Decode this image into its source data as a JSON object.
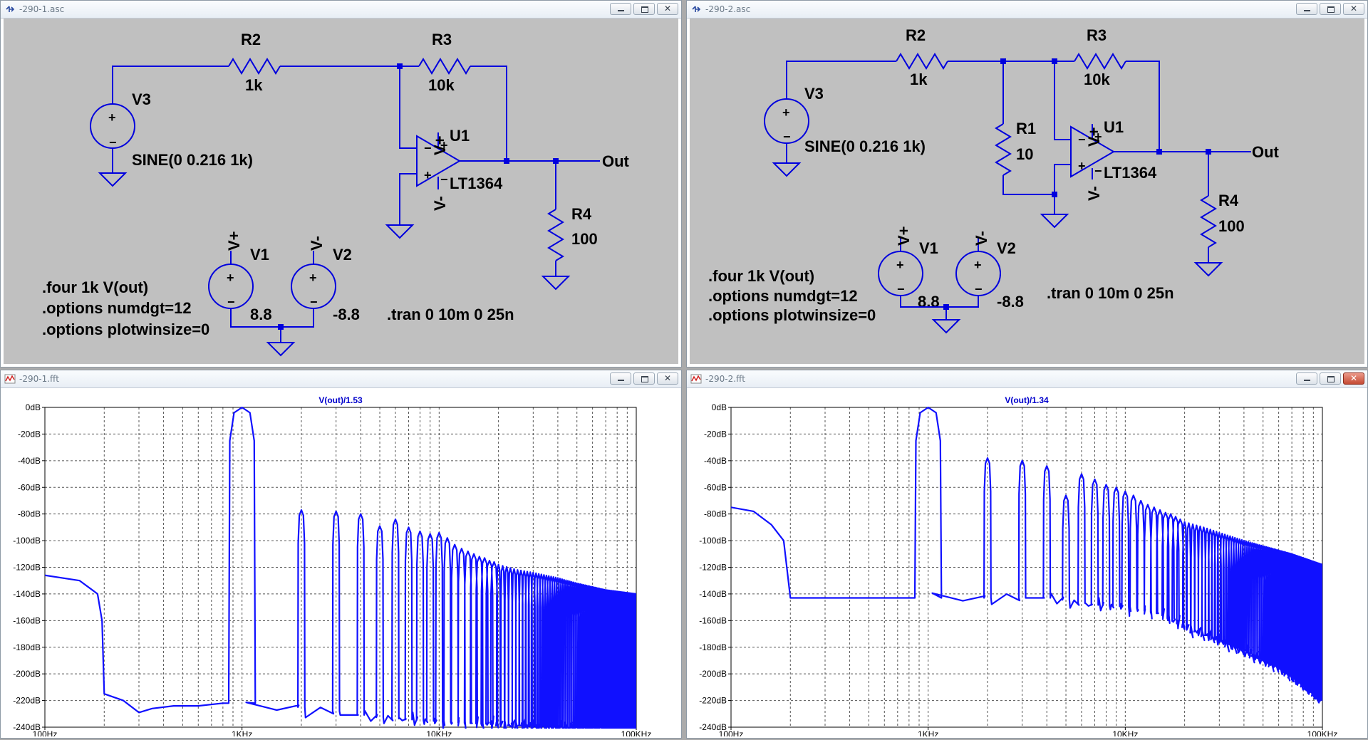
{
  "windows": {
    "sch1": {
      "title": "-290-1.asc"
    },
    "sch2": {
      "title": "-290-2.asc"
    },
    "fft1": {
      "title": "-290-1.fft"
    },
    "fft2": {
      "title": "-290-2.fft"
    }
  },
  "schematic1": {
    "r2": {
      "name": "R2",
      "value": "1k"
    },
    "r3": {
      "name": "R3",
      "value": "10k"
    },
    "r4": {
      "name": "R4",
      "value": "100"
    },
    "v3": {
      "name": "V3",
      "value": "SINE(0 0.216 1k)"
    },
    "u1": {
      "name": "U1",
      "model": "LT1364",
      "vplus": "V+",
      "vminus": "V-"
    },
    "v1": {
      "name": "V1",
      "value": "8.8",
      "net": "V+"
    },
    "v2": {
      "name": "V2",
      "value": "-8.8",
      "net": "V-"
    },
    "out": "Out",
    "directives": [
      ".four 1k V(out)",
      ".options numdgt=12",
      ".options plotwinsize=0"
    ],
    "tran": ".tran 0 10m 0 25n"
  },
  "schematic2": {
    "r1": {
      "name": "R1",
      "value": "10"
    },
    "r2": {
      "name": "R2",
      "value": "1k"
    },
    "r3": {
      "name": "R3",
      "value": "10k"
    },
    "r4": {
      "name": "R4",
      "value": "100"
    },
    "v3": {
      "name": "V3",
      "value": "SINE(0 0.216 1k)"
    },
    "u1": {
      "name": "U1",
      "model": "LT1364",
      "vplus": "V+",
      "vminus": "V-"
    },
    "v1": {
      "name": "V1",
      "value": "8.8",
      "net": "V+"
    },
    "v2": {
      "name": "V2",
      "value": "-8.8",
      "net": "V-"
    },
    "out": "Out",
    "directives": [
      ".four 1k V(out)",
      ".options numdgt=12",
      ".options plotwinsize=0"
    ],
    "tran": ".tran 0 10m 0 25n"
  },
  "chart_data": [
    {
      "type": "line",
      "title": "V(out)/1.53",
      "x_scale": "log",
      "xlim": [
        100,
        100000
      ],
      "ylim": [
        -240,
        0
      ],
      "y_ticks": [
        "0dB",
        "-20dB",
        "-40dB",
        "-60dB",
        "-80dB",
        "-100dB",
        "-120dB",
        "-140dB",
        "-160dB",
        "-180dB",
        "-200dB",
        "-220dB",
        "-240dB"
      ],
      "x_ticks": [
        "100Hz",
        "1KHz",
        "10KHz",
        "100KHz"
      ],
      "grid": true,
      "series": [
        {
          "color": "#1010ff",
          "baseline": [
            [
              100,
              -126
            ],
            [
              150,
              -130
            ],
            [
              185,
              -140
            ],
            [
              195,
              -160
            ],
            [
              200,
              -215
            ],
            [
              250,
              -220
            ],
            [
              300,
              -229
            ],
            [
              350,
              -226
            ],
            [
              450,
              -224
            ],
            [
              600,
              -224
            ],
            [
              800,
              -222
            ]
          ],
          "peaks": [
            [
              1000,
              0
            ],
            [
              2000,
              -77
            ],
            [
              3000,
              -78
            ],
            [
              4000,
              -80
            ],
            [
              5000,
              -89
            ],
            [
              6000,
              -84
            ],
            [
              7000,
              -90
            ],
            [
              8000,
              -93
            ],
            [
              9000,
              -95
            ],
            [
              10000,
              -94
            ],
            [
              11000,
              -98
            ],
            [
              12000,
              -103
            ],
            [
              13000,
              -106
            ],
            [
              14000,
              -108
            ],
            [
              15000,
              -110
            ],
            [
              16000,
              -112
            ],
            [
              17000,
              -113
            ],
            [
              18000,
              -115
            ],
            [
              19000,
              -116
            ],
            [
              20000,
              -118
            ],
            [
              25000,
              -122
            ],
            [
              30000,
              -124
            ],
            [
              40000,
              -128
            ],
            [
              50000,
              -132
            ],
            [
              70000,
              -137
            ],
            [
              100000,
              -140
            ]
          ],
          "floor": [
            [
              1500,
              -225
            ],
            [
              2500,
              -228
            ],
            [
              4000,
              -232
            ],
            [
              6000,
              -234
            ],
            [
              10000,
              -236
            ],
            [
              20000,
              -238
            ],
            [
              40000,
              -240
            ],
            [
              100000,
              -240
            ]
          ]
        }
      ]
    },
    {
      "type": "line",
      "title": "V(out)/1.34",
      "x_scale": "log",
      "xlim": [
        100,
        100000
      ],
      "ylim": [
        -240,
        0
      ],
      "y_ticks": [
        "0dB",
        "-20dB",
        "-40dB",
        "-60dB",
        "-80dB",
        "-100dB",
        "-120dB",
        "-140dB",
        "-160dB",
        "-180dB",
        "-200dB",
        "-220dB",
        "-240dB"
      ],
      "x_ticks": [
        "100Hz",
        "1KHz",
        "10KHz",
        "100KHz"
      ],
      "grid": true,
      "series": [
        {
          "color": "#1010ff",
          "baseline": [
            [
              100,
              -75
            ],
            [
              130,
              -78
            ],
            [
              160,
              -88
            ],
            [
              185,
              -100
            ],
            [
              200,
              -143
            ],
            [
              400,
              -143
            ],
            [
              800,
              -143
            ]
          ],
          "peaks": [
            [
              1000,
              0
            ],
            [
              2000,
              -38
            ],
            [
              3000,
              -40
            ],
            [
              4000,
              -44
            ],
            [
              5000,
              -66
            ],
            [
              6000,
              -50
            ],
            [
              7000,
              -54
            ],
            [
              8000,
              -58
            ],
            [
              9000,
              -60
            ],
            [
              10000,
              -63
            ],
            [
              11000,
              -66
            ],
            [
              12000,
              -70
            ],
            [
              13000,
              -73
            ],
            [
              14000,
              -75
            ],
            [
              15000,
              -77
            ],
            [
              16000,
              -79
            ],
            [
              17000,
              -80
            ],
            [
              18000,
              -82
            ],
            [
              19000,
              -84
            ],
            [
              20000,
              -86
            ],
            [
              25000,
              -90
            ],
            [
              30000,
              -94
            ],
            [
              40000,
              -100
            ],
            [
              50000,
              -104
            ],
            [
              70000,
              -110
            ],
            [
              100000,
              -118
            ]
          ],
          "floor": [
            [
              1500,
              -143
            ],
            [
              2500,
              -143
            ],
            [
              4000,
              -143
            ],
            [
              6000,
              -148
            ],
            [
              10000,
              -150
            ],
            [
              15000,
              -155
            ],
            [
              20000,
              -165
            ],
            [
              30000,
              -175
            ],
            [
              40000,
              -183
            ],
            [
              60000,
              -195
            ],
            [
              80000,
              -208
            ],
            [
              100000,
              -220
            ]
          ]
        }
      ]
    }
  ]
}
